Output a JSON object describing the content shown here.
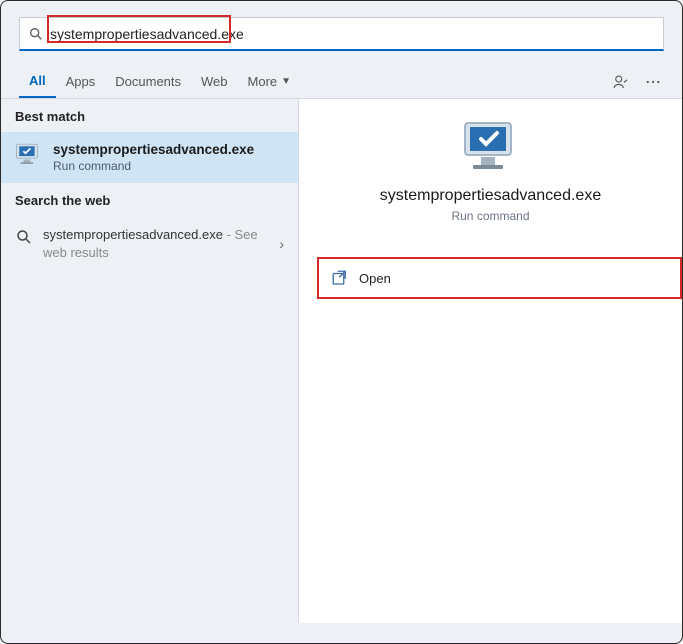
{
  "search": {
    "value": "systempropertiesadvanced.exe"
  },
  "tabs": {
    "all": "All",
    "apps": "Apps",
    "documents": "Documents",
    "web": "Web",
    "more": "More"
  },
  "left": {
    "best_header": "Best match",
    "best_title": "systempropertiesadvanced.exe",
    "best_sub": "Run command",
    "web_header": "Search the web",
    "web_title": "systempropertiesadvanced.exe",
    "web_suffix": " - See web results"
  },
  "detail": {
    "title": "systempropertiesadvanced.exe",
    "sub": "Run command"
  },
  "actions": {
    "open": "Open"
  }
}
